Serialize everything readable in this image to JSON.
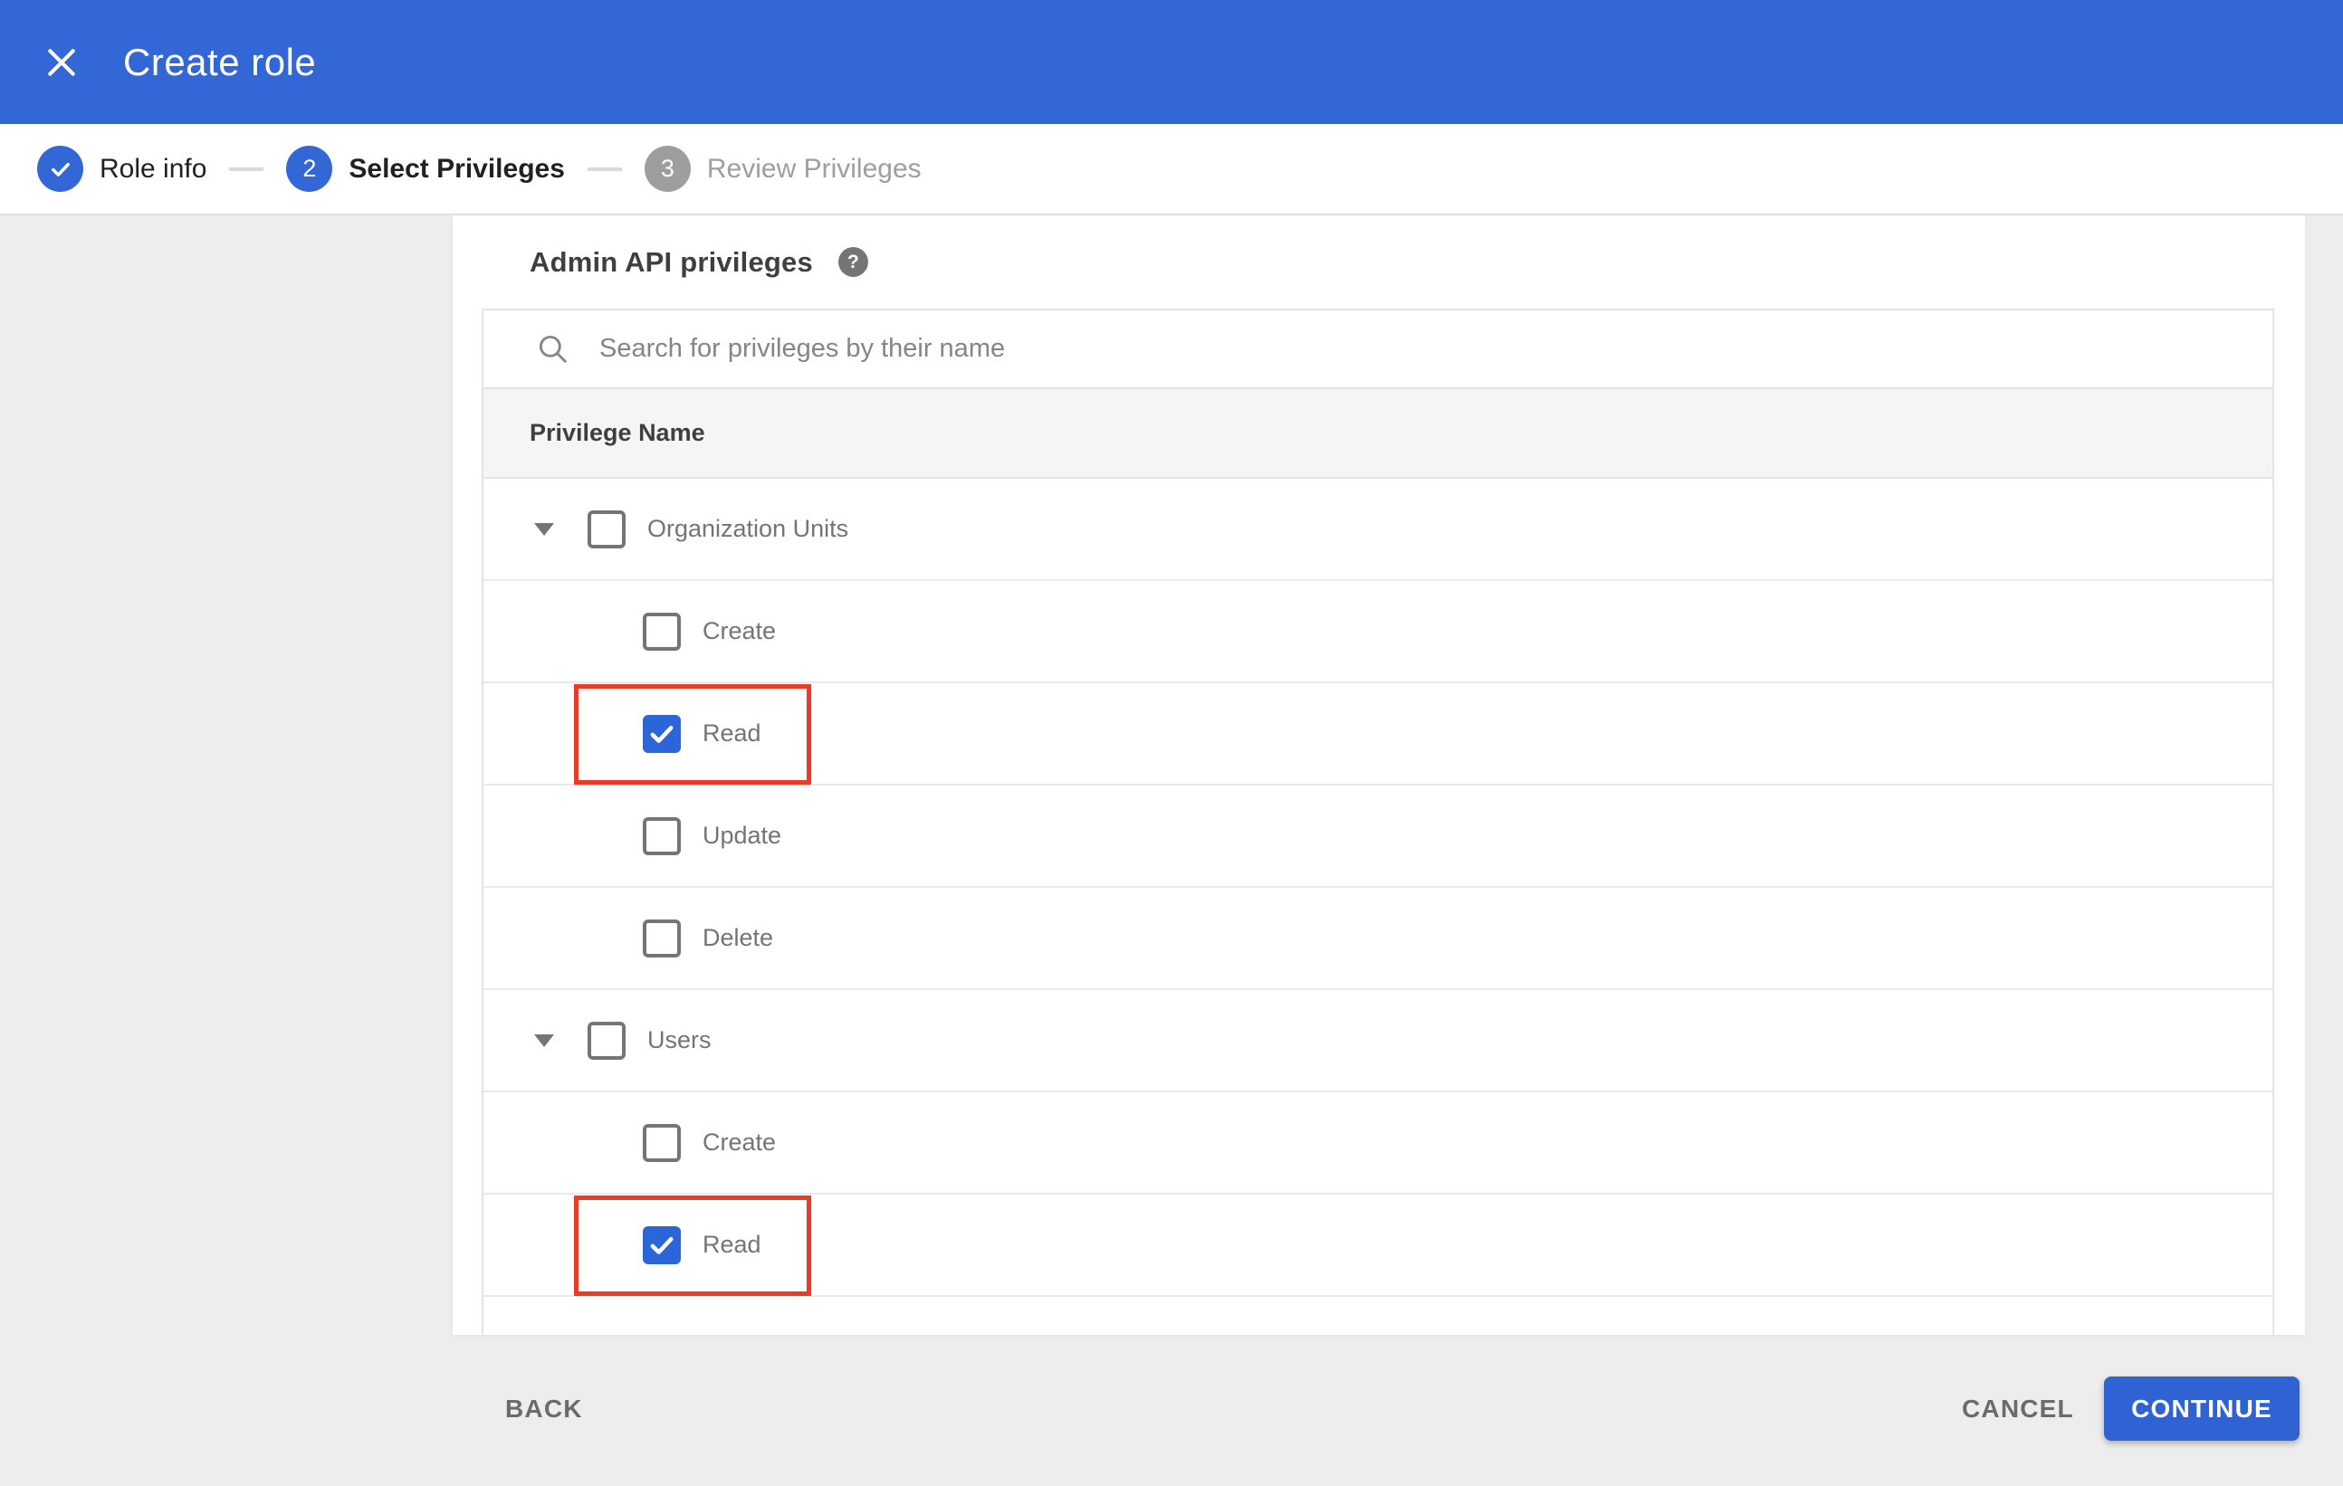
{
  "header": {
    "title": "Create role"
  },
  "stepper": {
    "steps": [
      {
        "label": "Role info",
        "state": "done"
      },
      {
        "label": "Select Privileges",
        "number": "2",
        "state": "active"
      },
      {
        "label": "Review Privileges",
        "number": "3",
        "state": "upcoming"
      }
    ]
  },
  "panel": {
    "heading": "Admin API privileges",
    "help_glyph": "?"
  },
  "search": {
    "placeholder": "Search for privileges by their name",
    "value": ""
  },
  "table": {
    "column_header": "Privilege Name",
    "groups": [
      {
        "label": "Organization Units",
        "checked": false,
        "expanded": true,
        "children": [
          {
            "label": "Create",
            "checked": false,
            "highlighted": false
          },
          {
            "label": "Read",
            "checked": true,
            "highlighted": true
          },
          {
            "label": "Update",
            "checked": false,
            "highlighted": false
          },
          {
            "label": "Delete",
            "checked": false,
            "highlighted": false
          }
        ]
      },
      {
        "label": "Users",
        "checked": false,
        "expanded": true,
        "children": [
          {
            "label": "Create",
            "checked": false,
            "highlighted": false
          },
          {
            "label": "Read",
            "checked": true,
            "highlighted": true
          }
        ]
      }
    ]
  },
  "footer": {
    "back_label": "BACK",
    "cancel_label": "CANCEL",
    "continue_label": "CONTINUE"
  },
  "colors": {
    "accent_blue": "#3367d6",
    "checkbox_checked_blue": "#2a66d9",
    "highlight_red": "#ea3b24",
    "page_background": "#ededed"
  }
}
